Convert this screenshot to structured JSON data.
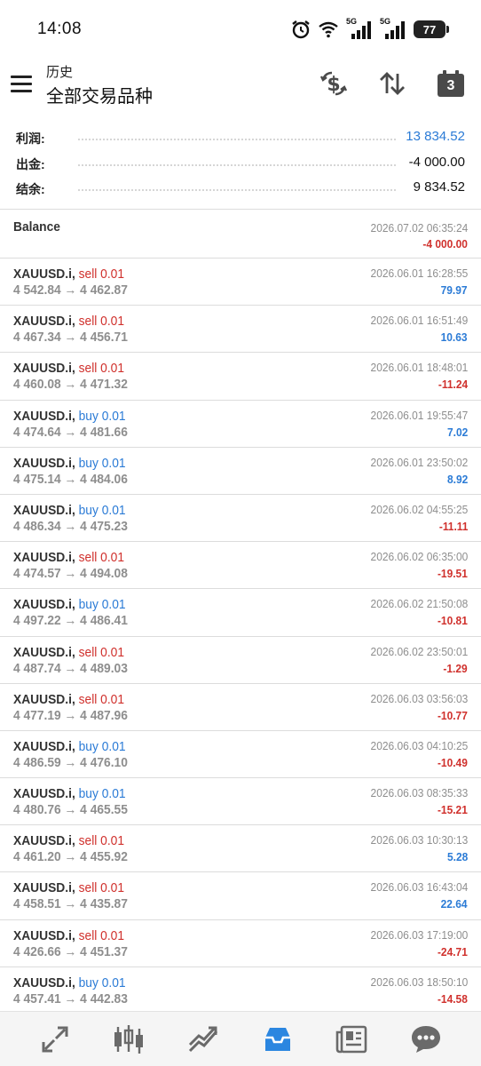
{
  "status_bar": {
    "time": "14:08",
    "signal1_label": "5G",
    "signal2_label": "5G",
    "battery": "77",
    "icons": [
      "alarm-icon",
      "wifi-icon",
      "signal-icon",
      "signal-icon",
      "battery-icon"
    ]
  },
  "header": {
    "subtitle": "历史",
    "title": "全部交易品种",
    "calendar_number": "3",
    "icons": [
      "menu-icon",
      "currency-swap-icon",
      "sort-icon",
      "calendar-icon"
    ]
  },
  "summary": {
    "profit_label": "利润:",
    "profit_value": "13 834.52",
    "withdraw_label": "出金:",
    "withdraw_value": "-4 000.00",
    "balance_label": "结余:",
    "balance_value": "9 834.52"
  },
  "balance_entry": {
    "label": "Balance",
    "time": "2026.07.02 06:35:24",
    "amount": "-4 000.00"
  },
  "trades": [
    {
      "symbol": "XAUUSD.i,",
      "dir": "sell 0.01",
      "type": "sell",
      "prices": "4 542.84 → 4 462.87",
      "time": "2026.06.01 16:28:55",
      "pl": "79.97",
      "sign": "pos"
    },
    {
      "symbol": "XAUUSD.i,",
      "dir": "sell 0.01",
      "type": "sell",
      "prices": "4 467.34 → 4 456.71",
      "time": "2026.06.01 16:51:49",
      "pl": "10.63",
      "sign": "pos"
    },
    {
      "symbol": "XAUUSD.i,",
      "dir": "sell 0.01",
      "type": "sell",
      "prices": "4 460.08 → 4 471.32",
      "time": "2026.06.01 18:48:01",
      "pl": "-11.24",
      "sign": "neg"
    },
    {
      "symbol": "XAUUSD.i,",
      "dir": "buy 0.01",
      "type": "buy",
      "prices": "4 474.64 → 4 481.66",
      "time": "2026.06.01 19:55:47",
      "pl": "7.02",
      "sign": "pos"
    },
    {
      "symbol": "XAUUSD.i,",
      "dir": "buy 0.01",
      "type": "buy",
      "prices": "4 475.14 → 4 484.06",
      "time": "2026.06.01 23:50:02",
      "pl": "8.92",
      "sign": "pos"
    },
    {
      "symbol": "XAUUSD.i,",
      "dir": "buy 0.01",
      "type": "buy",
      "prices": "4 486.34 → 4 475.23",
      "time": "2026.06.02 04:55:25",
      "pl": "-11.11",
      "sign": "neg"
    },
    {
      "symbol": "XAUUSD.i,",
      "dir": "sell 0.01",
      "type": "sell",
      "prices": "4 474.57 → 4 494.08",
      "time": "2026.06.02 06:35:00",
      "pl": "-19.51",
      "sign": "neg"
    },
    {
      "symbol": "XAUUSD.i,",
      "dir": "buy 0.01",
      "type": "buy",
      "prices": "4 497.22 → 4 486.41",
      "time": "2026.06.02 21:50:08",
      "pl": "-10.81",
      "sign": "neg"
    },
    {
      "symbol": "XAUUSD.i,",
      "dir": "sell 0.01",
      "type": "sell",
      "prices": "4 487.74 → 4 489.03",
      "time": "2026.06.02 23:50:01",
      "pl": "-1.29",
      "sign": "neg"
    },
    {
      "symbol": "XAUUSD.i,",
      "dir": "sell 0.01",
      "type": "sell",
      "prices": "4 477.19 → 4 487.96",
      "time": "2026.06.03 03:56:03",
      "pl": "-10.77",
      "sign": "neg"
    },
    {
      "symbol": "XAUUSD.i,",
      "dir": "buy 0.01",
      "type": "buy",
      "prices": "4 486.59 → 4 476.10",
      "time": "2026.06.03 04:10:25",
      "pl": "-10.49",
      "sign": "neg"
    },
    {
      "symbol": "XAUUSD.i,",
      "dir": "buy 0.01",
      "type": "buy",
      "prices": "4 480.76 → 4 465.55",
      "time": "2026.06.03 08:35:33",
      "pl": "-15.21",
      "sign": "neg"
    },
    {
      "symbol": "XAUUSD.i,",
      "dir": "sell 0.01",
      "type": "sell",
      "prices": "4 461.20 → 4 455.92",
      "time": "2026.06.03 10:30:13",
      "pl": "5.28",
      "sign": "pos"
    },
    {
      "symbol": "XAUUSD.i,",
      "dir": "sell 0.01",
      "type": "sell",
      "prices": "4 458.51 → 4 435.87",
      "time": "2026.06.03 16:43:04",
      "pl": "22.64",
      "sign": "pos"
    },
    {
      "symbol": "XAUUSD.i,",
      "dir": "sell 0.01",
      "type": "sell",
      "prices": "4 426.66 → 4 451.37",
      "time": "2026.06.03 17:19:00",
      "pl": "-24.71",
      "sign": "neg"
    },
    {
      "symbol": "XAUUSD.i,",
      "dir": "buy 0.01",
      "type": "buy",
      "prices": "4 457.41 → 4 442.83",
      "time": "2026.06.03 18:50:10",
      "pl": "-14.58",
      "sign": "neg"
    }
  ],
  "bottom_nav": {
    "items": [
      "quotes-icon",
      "chart-icon",
      "trade-icon",
      "history-icon",
      "news-icon",
      "chat-icon"
    ],
    "active": "history-icon"
  },
  "colors": {
    "accent_blue": "#2b7bd6",
    "loss_red": "#d0312d",
    "muted_gray": "#8e8e8e",
    "active_nav": "#2b86e0"
  }
}
